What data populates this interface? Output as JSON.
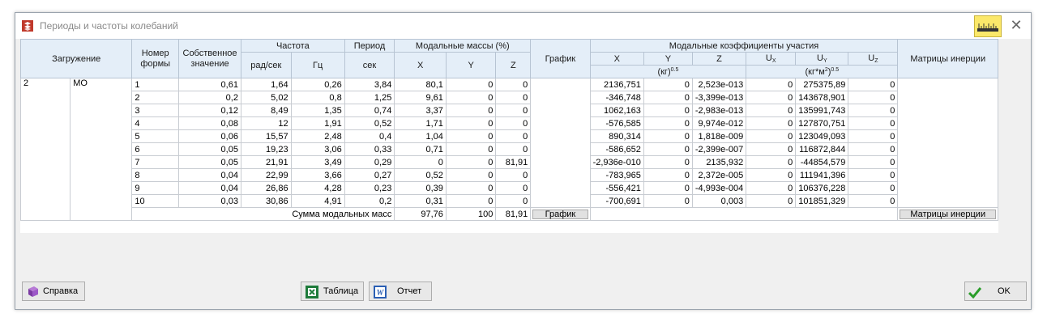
{
  "window": {
    "title": "Периоды и частоты колебаний"
  },
  "headers": {
    "loading": "Загружение",
    "form_no_1": "Номер",
    "form_no_2": "формы",
    "eigen_1": "Собственное",
    "eigen_2": "значение",
    "frequency": "Частота",
    "rad_s": "рад/сек",
    "hz": "Гц",
    "period": "Период",
    "sec": "сек",
    "modal_masses": "Модальные массы (%)",
    "x": "X",
    "y": "Y",
    "z": "Z",
    "graph": "График",
    "participation": "Модальные коэффициенты участия",
    "px": "X",
    "py": "Y",
    "pz": "Z",
    "ux": "U",
    "ux_sub": "X",
    "uy": "U",
    "uy_sub": "Y",
    "uz": "U",
    "uz_sub": "Z",
    "unit1": "(кг)",
    "unit1_sup": "0.5",
    "unit2": "(кг*м",
    "unit2_sup1": "2",
    "unit2_close": ")",
    "unit2_sup2": "0.5",
    "inertia": "Матрицы инерции"
  },
  "load_case": {
    "number": "2",
    "name": "МО"
  },
  "rows": [
    {
      "form": "1",
      "eig": "0,61",
      "rad": "1,64",
      "hz": "0,26",
      "per": "3,84",
      "mx": "80,1",
      "my": "0",
      "mz": "0",
      "px": "2136,751",
      "py": "0",
      "pz": "2,523e-013",
      "ux": "0",
      "uy": "275375,89",
      "uz": "0"
    },
    {
      "form": "2",
      "eig": "0,2",
      "rad": "5,02",
      "hz": "0,8",
      "per": "1,25",
      "mx": "9,61",
      "my": "0",
      "mz": "0",
      "px": "-346,748",
      "py": "0",
      "pz": "-3,399e-013",
      "ux": "0",
      "uy": "143678,901",
      "uz": "0"
    },
    {
      "form": "3",
      "eig": "0,12",
      "rad": "8,49",
      "hz": "1,35",
      "per": "0,74",
      "mx": "3,37",
      "my": "0",
      "mz": "0",
      "px": "1062,163",
      "py": "0",
      "pz": "-2,983e-013",
      "ux": "0",
      "uy": "135991,743",
      "uz": "0"
    },
    {
      "form": "4",
      "eig": "0,08",
      "rad": "12",
      "hz": "1,91",
      "per": "0,52",
      "mx": "1,71",
      "my": "0",
      "mz": "0",
      "px": "-576,585",
      "py": "0",
      "pz": "9,974e-012",
      "ux": "0",
      "uy": "127870,751",
      "uz": "0"
    },
    {
      "form": "5",
      "eig": "0,06",
      "rad": "15,57",
      "hz": "2,48",
      "per": "0,4",
      "mx": "1,04",
      "my": "0",
      "mz": "0",
      "px": "890,314",
      "py": "0",
      "pz": "1,818e-009",
      "ux": "0",
      "uy": "123049,093",
      "uz": "0"
    },
    {
      "form": "6",
      "eig": "0,05",
      "rad": "19,23",
      "hz": "3,06",
      "per": "0,33",
      "mx": "0,71",
      "my": "0",
      "mz": "0",
      "px": "-586,652",
      "py": "0",
      "pz": "-2,399e-007",
      "ux": "0",
      "uy": "116872,844",
      "uz": "0"
    },
    {
      "form": "7",
      "eig": "0,05",
      "rad": "21,91",
      "hz": "3,49",
      "per": "0,29",
      "mx": "0",
      "my": "0",
      "mz": "81,91",
      "px": "-2,936e-010",
      "py": "0",
      "pz": "2135,932",
      "ux": "0",
      "uy": "-44854,579",
      "uz": "0"
    },
    {
      "form": "8",
      "eig": "0,04",
      "rad": "22,99",
      "hz": "3,66",
      "per": "0,27",
      "mx": "0,52",
      "my": "0",
      "mz": "0",
      "px": "-783,965",
      "py": "0",
      "pz": "2,372e-005",
      "ux": "0",
      "uy": "111941,396",
      "uz": "0"
    },
    {
      "form": "9",
      "eig": "0,04",
      "rad": "26,86",
      "hz": "4,28",
      "per": "0,23",
      "mx": "0,39",
      "my": "0",
      "mz": "0",
      "px": "-556,421",
      "py": "0",
      "pz": "-4,993e-004",
      "ux": "0",
      "uy": "106376,228",
      "uz": "0"
    },
    {
      "form": "10",
      "eig": "0,03",
      "rad": "30,86",
      "hz": "4,91",
      "per": "0,2",
      "mx": "0,31",
      "my": "0",
      "mz": "0",
      "px": "-700,691",
      "py": "0",
      "pz": "0,003",
      "ux": "0",
      "uy": "101851,329",
      "uz": "0"
    }
  ],
  "sum": {
    "label": "Сумма модальных масс",
    "x": "97,76",
    "y": "100",
    "z": "81,91"
  },
  "buttons": {
    "graph": "График",
    "inertia": "Матрицы инерции",
    "help": "Справка",
    "table": "Таблица",
    "report": "Отчет",
    "ok": "OK"
  },
  "colors": {
    "header_bg": "#e4eef8",
    "excel_green": "#1d7a3a",
    "word_blue": "#2b5fb4",
    "ok_green": "#2a9d2a",
    "ruler_yellow": "#fbe86a"
  }
}
